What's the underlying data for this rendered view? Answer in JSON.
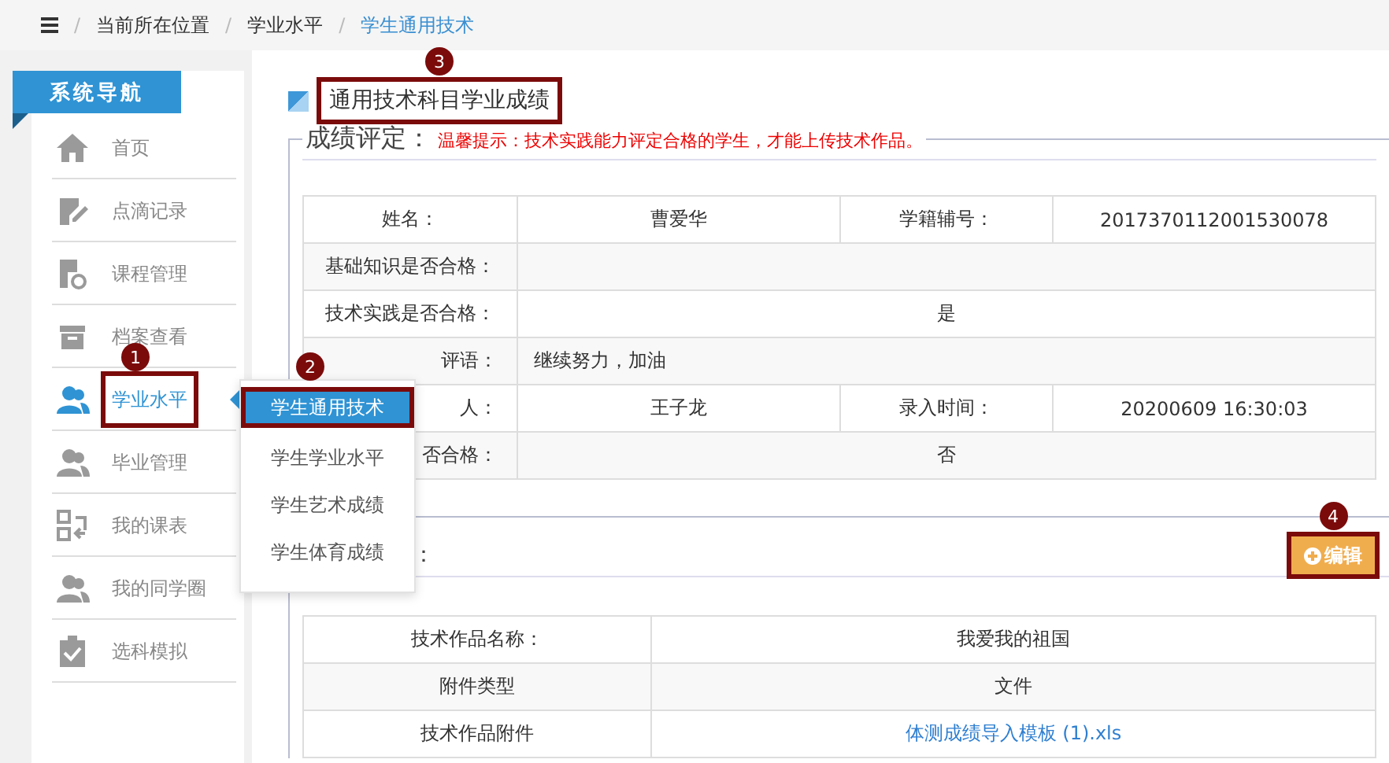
{
  "breadcrumb": {
    "separator": "/",
    "items": [
      {
        "label": "当前所在位置",
        "current": false
      },
      {
        "label": "学业水平",
        "current": false
      },
      {
        "label": "学生通用技术",
        "current": true
      }
    ]
  },
  "sidebar": {
    "title": "系统导航",
    "items": [
      {
        "label": "首页",
        "kind": "home",
        "selected": false
      },
      {
        "label": "点滴记录",
        "kind": "edit",
        "selected": false
      },
      {
        "label": "课程管理",
        "kind": "course",
        "selected": false
      },
      {
        "label": "档案查看",
        "kind": "archive",
        "selected": false
      },
      {
        "label": "学业水平",
        "kind": "users",
        "selected": true,
        "annotation": "1"
      },
      {
        "label": "毕业管理",
        "kind": "users",
        "selected": false
      },
      {
        "label": "我的课表",
        "kind": "swap",
        "selected": false
      },
      {
        "label": "我的同学圈",
        "kind": "users",
        "selected": false
      },
      {
        "label": "选科模拟",
        "kind": "clipboard",
        "selected": false
      }
    ]
  },
  "submenu": {
    "items": [
      {
        "label": "学生通用技术",
        "selected": true,
        "annotation": "2"
      },
      {
        "label": "学生学业水平",
        "selected": false
      },
      {
        "label": "学生艺术成绩",
        "selected": false
      },
      {
        "label": "学生体育成绩",
        "selected": false
      }
    ]
  },
  "page_title": {
    "text": "通用技术科目学业成绩",
    "annotation": "3"
  },
  "grade_section": {
    "legend": "成绩评定：",
    "hint": "温馨提示：技术实践能力评定合格的学生，才能上传技术作品。",
    "rows": [
      {
        "cells": [
          {
            "kind": "label",
            "text": "姓名："
          },
          {
            "kind": "value",
            "text": "曹爱华"
          },
          {
            "kind": "label",
            "text": "学籍辅号："
          },
          {
            "kind": "value",
            "text": "2017370112001530078"
          }
        ]
      },
      {
        "cells": [
          {
            "kind": "label",
            "text": "基础知识是否合格："
          },
          {
            "kind": "value",
            "colspan": 3
          }
        ]
      },
      {
        "cells": [
          {
            "kind": "label",
            "text": "技术实践是否合格："
          },
          {
            "kind": "value",
            "text": "是",
            "colspan": 3
          }
        ]
      },
      {
        "cells": [
          {
            "kind": "cut-label",
            "text": "评语："
          },
          {
            "kind": "note",
            "text": "继续努力，加油",
            "colspan": 3
          }
        ]
      },
      {
        "cells": [
          {
            "kind": "cut-label",
            "text": "人："
          },
          {
            "kind": "value",
            "text": "王子龙"
          },
          {
            "kind": "label",
            "text": "录入时间："
          },
          {
            "kind": "value",
            "text": "20200609 16:30:03"
          }
        ]
      },
      {
        "cells": [
          {
            "kind": "cut-label",
            "text": "否合格："
          },
          {
            "kind": "value",
            "text": "否",
            "colspan": 3
          }
        ]
      }
    ]
  },
  "work_section": {
    "legend": "：",
    "edit_button": {
      "label": "编辑",
      "annotation": "4"
    },
    "rows": [
      {
        "cells": [
          {
            "kind": "label",
            "text": "技术作品名称："
          },
          {
            "kind": "value",
            "text": "我爱我的祖国"
          }
        ]
      },
      {
        "cells": [
          {
            "kind": "label",
            "text": "附件类型"
          },
          {
            "kind": "value",
            "text": "文件"
          }
        ]
      },
      {
        "cells": [
          {
            "kind": "label",
            "text": "技术作品附件"
          },
          {
            "kind": "link",
            "text": "体测成绩导入模板 (1).xls"
          }
        ]
      }
    ]
  }
}
